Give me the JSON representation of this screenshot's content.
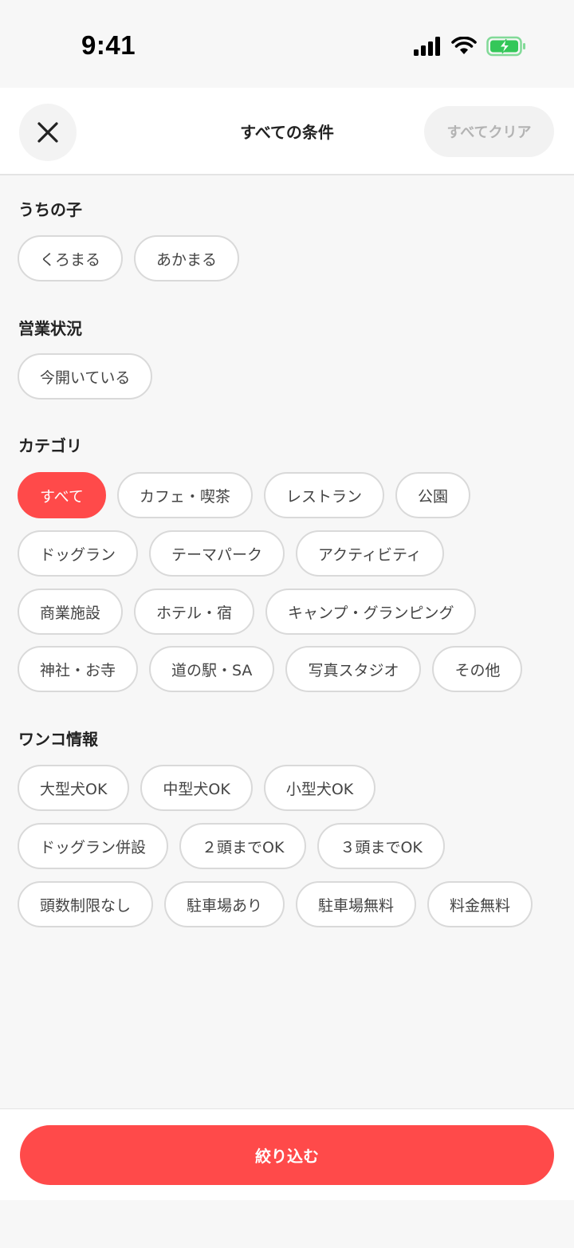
{
  "status_bar": {
    "time": "9:41",
    "icons": [
      "cellular-signal-icon",
      "wifi-icon",
      "battery-charging-icon"
    ],
    "battery_color": "#34c759"
  },
  "header": {
    "close_icon": "close-icon",
    "title": "すべての条件",
    "clear_label": "すべてクリア"
  },
  "sections": {
    "my_dogs": {
      "title": "うちの子",
      "chips": [
        "くろまる",
        "あかまる"
      ]
    },
    "business": {
      "title": "営業状況",
      "chips": [
        "今開いている"
      ]
    },
    "category": {
      "title": "カテゴリ",
      "selected": "すべて",
      "rows": [
        [
          "すべて",
          "カフェ・喫茶",
          "レストラン",
          "公園"
        ],
        [
          "ドッグラン",
          "テーマパーク",
          "アクティビティ"
        ],
        [
          "商業施設",
          "ホテル・宿",
          "キャンプ・グランピング"
        ],
        [
          "神社・お寺",
          "道の駅・SA",
          "写真スタジオ",
          "その他"
        ]
      ]
    },
    "dog_info": {
      "title": "ワンコ情報",
      "rows": [
        [
          "大型犬OK",
          "中型犬OK",
          "小型犬OK"
        ],
        [
          "ドッグラン併設",
          "２頭までOK",
          "３頭までOK"
        ],
        [
          "頭数制限なし",
          "駐車場あり",
          "駐車場無料",
          "料金無料"
        ]
      ]
    }
  },
  "footer": {
    "submit_label": "絞り込む"
  },
  "colors": {
    "accent": "#ff4a4a",
    "background": "#f7f7f7",
    "chip_border": "#d9d9d9"
  }
}
